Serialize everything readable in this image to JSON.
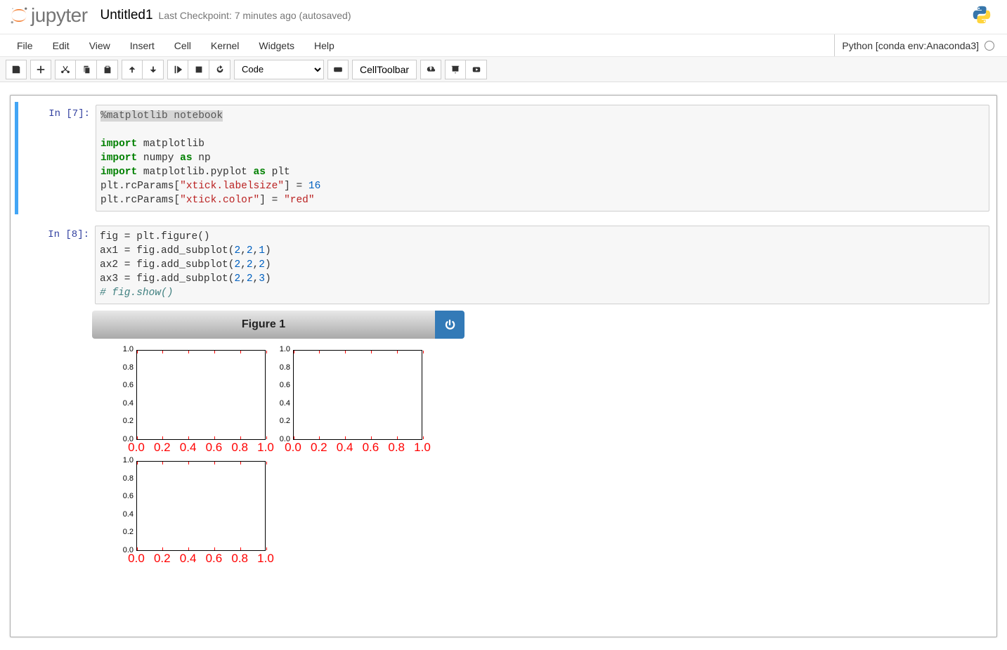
{
  "header": {
    "logo_text": "jupyter",
    "notebook_name": "Untitled1",
    "checkpoint": "Last Checkpoint: 7 minutes ago (autosaved)"
  },
  "menubar": {
    "items": [
      "File",
      "Edit",
      "View",
      "Insert",
      "Cell",
      "Kernel",
      "Widgets",
      "Help"
    ],
    "kernel_label": "Python [conda env:Anaconda3]"
  },
  "toolbar": {
    "cell_type": "Code",
    "cell_toolbar_label": "CellToolbar"
  },
  "cells": [
    {
      "prompt": "In  [7]:",
      "code_segments": [
        {
          "t": "%matplotlib notebook",
          "c": "cm-magic"
        },
        {
          "t": "\n\n"
        },
        {
          "t": "import",
          "c": "cm-kw"
        },
        {
          "t": " matplotlib\n"
        },
        {
          "t": "import",
          "c": "cm-kw"
        },
        {
          "t": " numpy "
        },
        {
          "t": "as",
          "c": "cm-kw"
        },
        {
          "t": " np\n"
        },
        {
          "t": "import",
          "c": "cm-kw"
        },
        {
          "t": " matplotlib.pyplot "
        },
        {
          "t": "as",
          "c": "cm-kw"
        },
        {
          "t": " plt\n"
        },
        {
          "t": "plt.rcParams["
        },
        {
          "t": "\"xtick.labelsize\"",
          "c": "cm-str"
        },
        {
          "t": "] = "
        },
        {
          "t": "16",
          "c": "cm-num"
        },
        {
          "t": "\n"
        },
        {
          "t": "plt.rcParams["
        },
        {
          "t": "\"xtick.color\"",
          "c": "cm-str"
        },
        {
          "t": "] = "
        },
        {
          "t": "\"red\"",
          "c": "cm-str"
        }
      ]
    },
    {
      "prompt": "In  [8]:",
      "code_segments": [
        {
          "t": "fig = plt.figure()\n"
        },
        {
          "t": "ax1 = fig.add_subplot("
        },
        {
          "t": "2",
          "c": "cm-num"
        },
        {
          "t": ","
        },
        {
          "t": "2",
          "c": "cm-num"
        },
        {
          "t": ","
        },
        {
          "t": "1",
          "c": "cm-num"
        },
        {
          "t": ")\n"
        },
        {
          "t": "ax2 = fig.add_subplot("
        },
        {
          "t": "2",
          "c": "cm-num"
        },
        {
          "t": ","
        },
        {
          "t": "2",
          "c": "cm-num"
        },
        {
          "t": ","
        },
        {
          "t": "2",
          "c": "cm-num"
        },
        {
          "t": ")\n"
        },
        {
          "t": "ax3 = fig.add_subplot("
        },
        {
          "t": "2",
          "c": "cm-num"
        },
        {
          "t": ","
        },
        {
          "t": "2",
          "c": "cm-num"
        },
        {
          "t": ","
        },
        {
          "t": "3",
          "c": "cm-num"
        },
        {
          "t": ")\n"
        },
        {
          "t": "# fig.show()",
          "c": "cm-cmt"
        }
      ]
    }
  ],
  "figure": {
    "title": "Figure 1"
  },
  "chart_data": [
    {
      "type": "line",
      "title": "",
      "xlabel": "",
      "ylabel": "",
      "xlim": [
        0.0,
        1.0
      ],
      "ylim": [
        0.0,
        1.0
      ],
      "xticks": [
        0.0,
        0.2,
        0.4,
        0.6,
        0.8,
        1.0
      ],
      "yticks": [
        0.0,
        0.2,
        0.4,
        0.6,
        0.8,
        1.0
      ],
      "xtick_labels": [
        "0.0",
        "0.2",
        "0.4",
        "0.6",
        "0.8",
        "1.0"
      ],
      "ytick_labels": [
        "0.0",
        "0.2",
        "0.4",
        "0.6",
        "0.8",
        "1.0"
      ],
      "xtick_color": "red",
      "xtick_labelsize": 16,
      "series": []
    },
    {
      "type": "line",
      "title": "",
      "xlabel": "",
      "ylabel": "",
      "xlim": [
        0.0,
        1.0
      ],
      "ylim": [
        0.0,
        1.0
      ],
      "xticks": [
        0.0,
        0.2,
        0.4,
        0.6,
        0.8,
        1.0
      ],
      "yticks": [
        0.0,
        0.2,
        0.4,
        0.6,
        0.8,
        1.0
      ],
      "xtick_labels": [
        "0.0",
        "0.2",
        "0.4",
        "0.6",
        "0.8",
        "1.0"
      ],
      "ytick_labels": [
        "0.0",
        "0.2",
        "0.4",
        "0.6",
        "0.8",
        "1.0"
      ],
      "xtick_color": "red",
      "xtick_labelsize": 16,
      "series": []
    },
    {
      "type": "line",
      "title": "",
      "xlabel": "",
      "ylabel": "",
      "xlim": [
        0.0,
        1.0
      ],
      "ylim": [
        0.0,
        1.0
      ],
      "xticks": [
        0.0,
        0.2,
        0.4,
        0.6,
        0.8,
        1.0
      ],
      "yticks": [
        0.0,
        0.2,
        0.4,
        0.6,
        0.8,
        1.0
      ],
      "xtick_labels": [
        "0.0",
        "0.2",
        "0.4",
        "0.6",
        "0.8",
        "1.0"
      ],
      "ytick_labels": [
        "0.0",
        "0.2",
        "0.4",
        "0.6",
        "0.8",
        "1.0"
      ],
      "xtick_color": "red",
      "xtick_labelsize": 16,
      "series": []
    }
  ]
}
